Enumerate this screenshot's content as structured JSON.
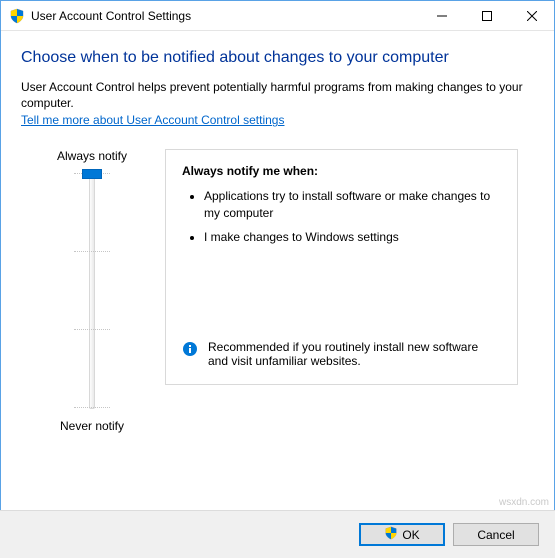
{
  "window": {
    "title": "User Account Control Settings"
  },
  "heading": "Choose when to be notified about changes to your computer",
  "description": "User Account Control helps prevent potentially harmful programs from making changes to your computer.",
  "help_link": "Tell me more about User Account Control settings",
  "slider": {
    "top_label": "Always notify",
    "bottom_label": "Never notify"
  },
  "info": {
    "title": "Always notify me when:",
    "bullets": [
      "Applications try to install software or make changes to my computer",
      "I make changes to Windows settings"
    ],
    "recommendation": "Recommended if you routinely install new software and visit unfamiliar websites."
  },
  "buttons": {
    "ok": "OK",
    "cancel": "Cancel"
  },
  "watermark": "wsxdn.com"
}
